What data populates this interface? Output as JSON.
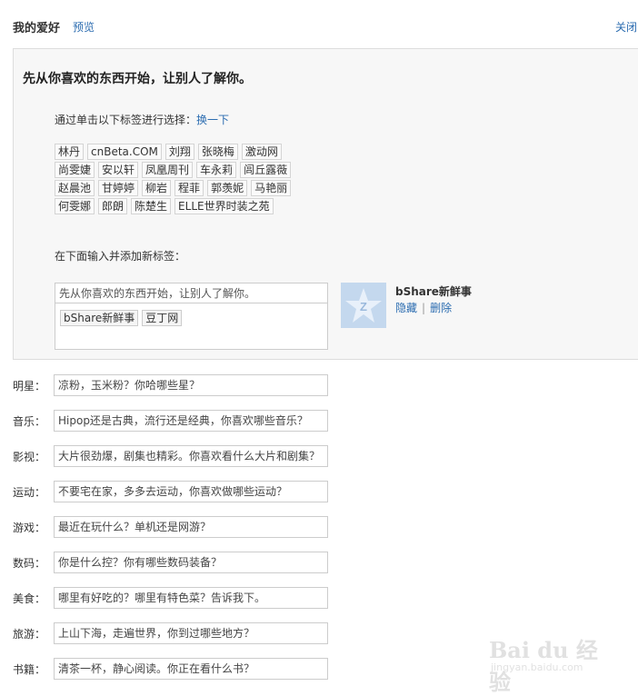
{
  "header": {
    "title": "我的爱好",
    "preview": "预览",
    "close": "关闭"
  },
  "panel": {
    "headline": "先从你喜欢的东西开始，让别人了解你。",
    "instruction": "通过单击以下标签进行选择：",
    "instruction_link": "换一下",
    "tag_rows": [
      [
        "林丹",
        "cnBeta.COM",
        "刘翔",
        "张晓梅",
        "激动网"
      ],
      [
        "尚雯婕",
        "安以轩",
        "凤凰周刊",
        "车永莉",
        "闾丘露薇"
      ],
      [
        "赵晨池",
        "甘婷婷",
        "柳岩",
        "程菲",
        "郭羡妮",
        "马艳丽"
      ],
      [
        "何雯娜",
        "郎朗",
        "陈楚生",
        "ELLE世界时装之苑"
      ]
    ],
    "add_label": "在下面输入并添加新标签：",
    "input_value": "先从你喜欢的东西开始，让别人了解你。",
    "chips": [
      "bShare新鲜事",
      "豆丁网"
    ],
    "bshare": {
      "name": "bShare新鲜事",
      "hide": "隐藏",
      "delete": "删除"
    }
  },
  "fields": [
    {
      "label": "明星：",
      "value": "凉粉，玉米粉？你哈哪些星？"
    },
    {
      "label": "音乐：",
      "value": "Hipop还是古典，流行还是经典，你喜欢哪些音乐？"
    },
    {
      "label": "影视：",
      "value": "大片很劲爆，剧集也精彩。你喜欢看什么大片和剧集？"
    },
    {
      "label": "运动：",
      "value": "不要宅在家，多多去运动，你喜欢做哪些运动？"
    },
    {
      "label": "游戏：",
      "value": "最近在玩什么？单机还是网游？"
    },
    {
      "label": "数码：",
      "value": "你是什么控？你有哪些数码装备？"
    },
    {
      "label": "美食：",
      "value": "哪里有好吃的？哪里有特色菜？告诉我下。"
    },
    {
      "label": "旅游：",
      "value": "上山下海，走遍世界，你到过哪些地方？"
    },
    {
      "label": "书籍：",
      "value": "清茶一杯，静心阅读。你正在看什么书？"
    }
  ],
  "watermark": {
    "brand": "Bai du 经验",
    "sub": "jingyan.baidu.com"
  }
}
